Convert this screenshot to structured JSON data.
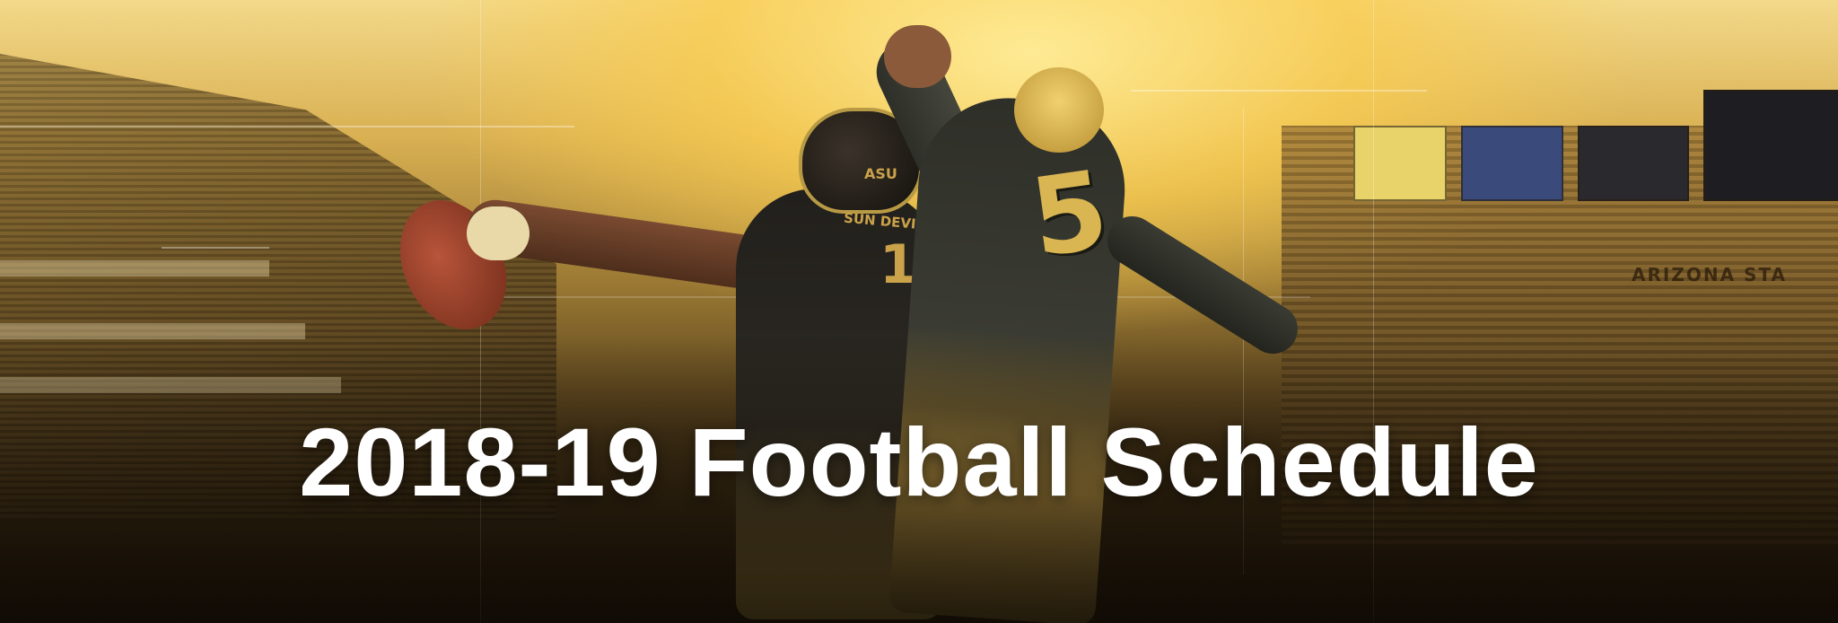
{
  "hero": {
    "title": "2018-19 Football Schedule",
    "helmet_text": "ASU",
    "chest_text": "SUN DEVILS",
    "jersey_number_left": "1",
    "jersey_number_right": "5",
    "stadium_banner": "ARIZONA STA"
  },
  "colors": {
    "gold": "#c9a24a",
    "maroon_black": "#22201c",
    "title_text": "#ffffff"
  }
}
